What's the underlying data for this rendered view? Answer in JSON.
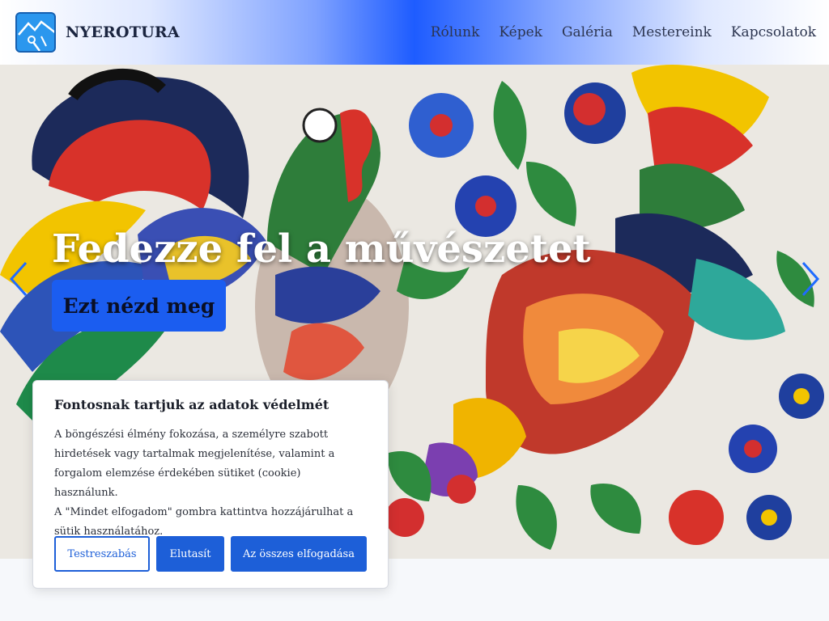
{
  "header": {
    "brand": "NYEROTURA",
    "nav": [
      "Rólunk",
      "Képek",
      "Galéria",
      "Mestereink",
      "Kapcsolatok"
    ]
  },
  "hero": {
    "title": "Fedezze fel a művészetet",
    "cta_label": "Ezt nézd meg"
  },
  "cookie": {
    "title": "Fontosnak tartjuk az adatok védelmét",
    "text_lines": [
      "A böngészési élmény fokozása, a személyre szabott",
      "hirdetések vagy tartalmak megjelenítése, valamint a",
      "forgalom elemzése érdekében sütiket (cookie) használunk.",
      "A \"Mindet elfogadom\" gombra kattintva hozzájárulhat a",
      "sütik használatához."
    ],
    "buttons": {
      "customize": "Testreszabás",
      "reject": "Elutasít",
      "accept_all": "Az összes elfogadása"
    }
  },
  "colors": {
    "accent": "#1d5fd8",
    "cta": "#1b5df0",
    "arrow": "#1f6bff"
  },
  "icons": {
    "logo": "mountain-logo-icon",
    "prev": "chevron-left-icon",
    "next": "chevron-right-icon"
  }
}
